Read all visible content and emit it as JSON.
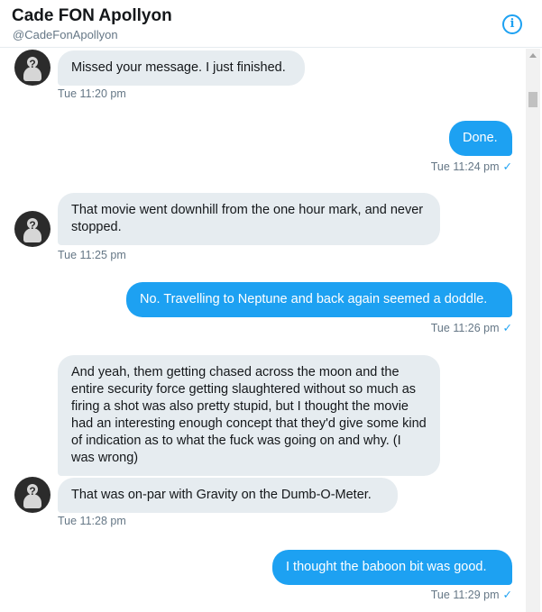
{
  "header": {
    "name": "Cade FON Apollyon",
    "handle": "@CadeFonApollyon",
    "info_icon": "ⓘ"
  },
  "messages": [
    {
      "text": "Missed your message. I just finished.",
      "time": "Tue 11:20 pm"
    },
    {
      "text": "Done.",
      "time": "Tue 11:24 pm",
      "status": "✓"
    },
    {
      "text": "That movie went downhill from the one hour mark, and never stopped.",
      "time": "Tue 11:25 pm"
    },
    {
      "text": "No. Travelling to Neptune and back again seemed a doddle.",
      "time": "Tue 11:26 pm",
      "status": "✓"
    },
    {
      "text": "And yeah, them getting chased across the moon and the entire security force getting slaughtered without so much as firing a shot was also pretty stupid, but I thought the movie had an interesting enough concept that they'd give some kind of indication as to what the fuck was going on and why. (I was wrong)"
    },
    {
      "text": "That was on-par with Gravity on the Dumb-O-Meter.",
      "time": "Tue 11:28 pm"
    },
    {
      "text": "I thought the baboon bit was good.",
      "time": "Tue 11:29 pm",
      "status": "✓"
    }
  ],
  "colors": {
    "accent": "#1da1f2",
    "incoming_bubble": "#e6ecf0",
    "timestamp": "#657786"
  }
}
